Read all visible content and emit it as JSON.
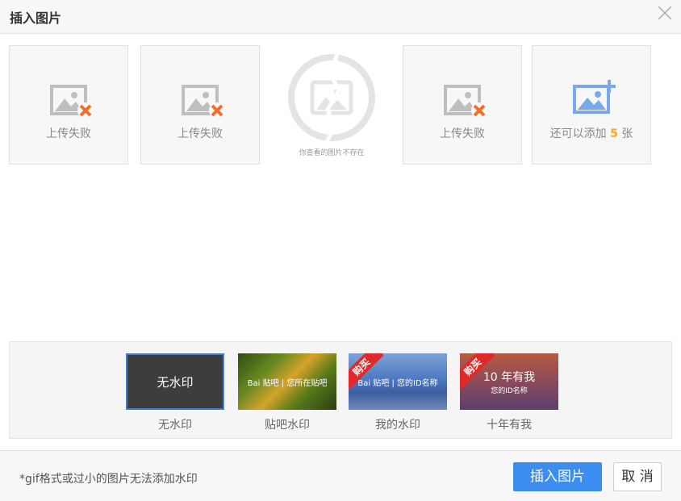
{
  "dialog": {
    "title": "插入图片"
  },
  "icons": {
    "close": "close-icon",
    "failed": "image-failed-icon",
    "add": "add-image-icon",
    "broken": "broken-image-icon"
  },
  "thumbnails": [
    {
      "status": "failed",
      "label": "上传失败"
    },
    {
      "status": "failed",
      "label": "上传失败"
    },
    {
      "status": "missing",
      "label": "你查看的图片不存在"
    },
    {
      "status": "failed",
      "label": "上传失败"
    }
  ],
  "add_tile": {
    "prefix": "还可以添加",
    "count": "5",
    "suffix": "张"
  },
  "watermarks": [
    {
      "label": "无水印",
      "preview_text": "无水印",
      "selected": true
    },
    {
      "label": "贴吧水印",
      "preview_text": "Bai 贴吧 | 您所在贴吧",
      "selected": false
    },
    {
      "label": "我的水印",
      "preview_text": "Bai 贴吧 | 您的ID名称",
      "badge": "购买",
      "selected": false
    },
    {
      "label": "十年有我",
      "preview_text": "10 年有我",
      "preview_sub": "您的ID名称",
      "badge": "购买",
      "selected": false
    }
  ],
  "footer": {
    "note": "*gif格式或过小的图片无法添加水印",
    "insert_label": "插入图片",
    "cancel_label": "取 消"
  },
  "colors": {
    "primary": "#3b8ef0",
    "accent": "#f5a623",
    "error": "#f26f2a",
    "badge": "#e02a2a"
  }
}
